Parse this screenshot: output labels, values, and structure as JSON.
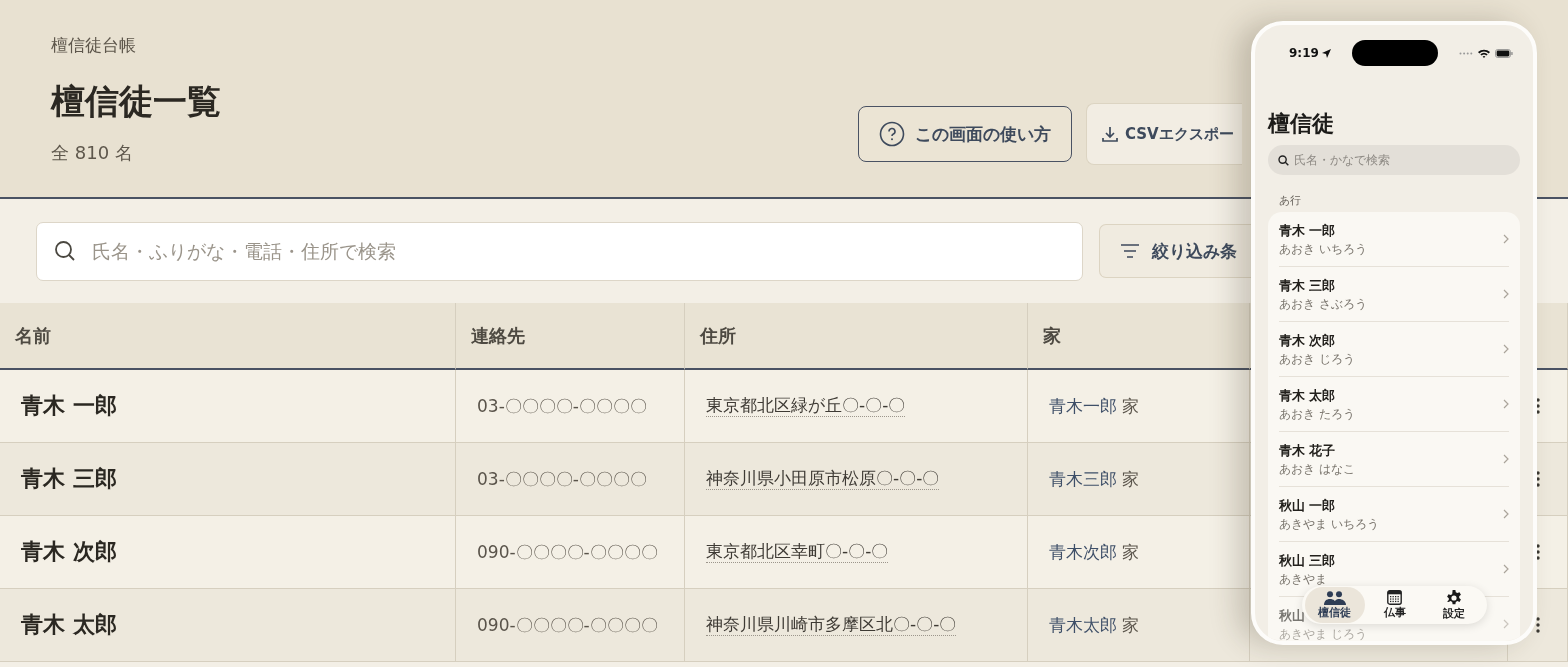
{
  "breadcrumb": "檀信徒台帳",
  "title": "檀信徒一覧",
  "count": "全 810 名",
  "header_buttons": [
    {
      "kind": "help",
      "label": "この画面の使い方"
    },
    {
      "kind": "export",
      "label": "CSVエクスポー"
    }
  ],
  "search": {
    "placeholder": "氏名・ふりがな・電話・住所で検索"
  },
  "filter_button": {
    "label": "絞り込み条"
  },
  "table": {
    "columns": [
      "名前",
      "連絡先",
      "住所",
      "家"
    ],
    "rows": [
      {
        "name": "青木 一郎",
        "phone": "03-〇〇〇〇-〇〇〇〇",
        "address": "東京都北区緑が丘〇-〇-〇",
        "family": "青木一郎",
        "family_suffix": "家"
      },
      {
        "name": "青木 三郎",
        "phone": "03-〇〇〇〇-〇〇〇〇",
        "address": "神奈川県小田原市松原〇-〇-〇",
        "family": "青木三郎",
        "family_suffix": "家"
      },
      {
        "name": "青木 次郎",
        "phone": "090-〇〇〇〇-〇〇〇〇",
        "address": "東京都北区幸町〇-〇-〇",
        "family": "青木次郎",
        "family_suffix": "家"
      },
      {
        "name": "青木 太郎",
        "phone": "090-〇〇〇〇-〇〇〇〇",
        "address": "神奈川県川崎市多摩区北〇-〇-〇",
        "family": "青木太郎",
        "family_suffix": "家"
      }
    ]
  },
  "phone": {
    "status_bar": {
      "time": "9:19"
    },
    "title": "檀信徒",
    "search": {
      "placeholder": "氏名・かなで検索"
    },
    "section": "あ行",
    "items": [
      {
        "name": "青木 一郎",
        "kana": "あおき いちろう",
        "faded": false
      },
      {
        "name": "青木 三郎",
        "kana": "あおき さぶろう",
        "faded": false
      },
      {
        "name": "青木 次郎",
        "kana": "あおき じろう",
        "faded": false
      },
      {
        "name": "青木 太郎",
        "kana": "あおき たろう",
        "faded": false
      },
      {
        "name": "青木 花子",
        "kana": "あおき はなこ",
        "faded": false
      },
      {
        "name": "秋山 一郎",
        "kana": "あきやま いちろう",
        "faded": false
      },
      {
        "name": "秋山 三郎",
        "kana": "あきやま",
        "faded": false
      },
      {
        "name": "秋山",
        "kana": "あきやま じろう",
        "faded": true
      }
    ],
    "tab_bar": [
      {
        "kind": "people",
        "label": "檀信徒",
        "selected": true
      },
      {
        "kind": "calendar",
        "label": "仏事",
        "selected": false
      },
      {
        "kind": "settings",
        "label": "設定",
        "selected": false
      }
    ]
  }
}
